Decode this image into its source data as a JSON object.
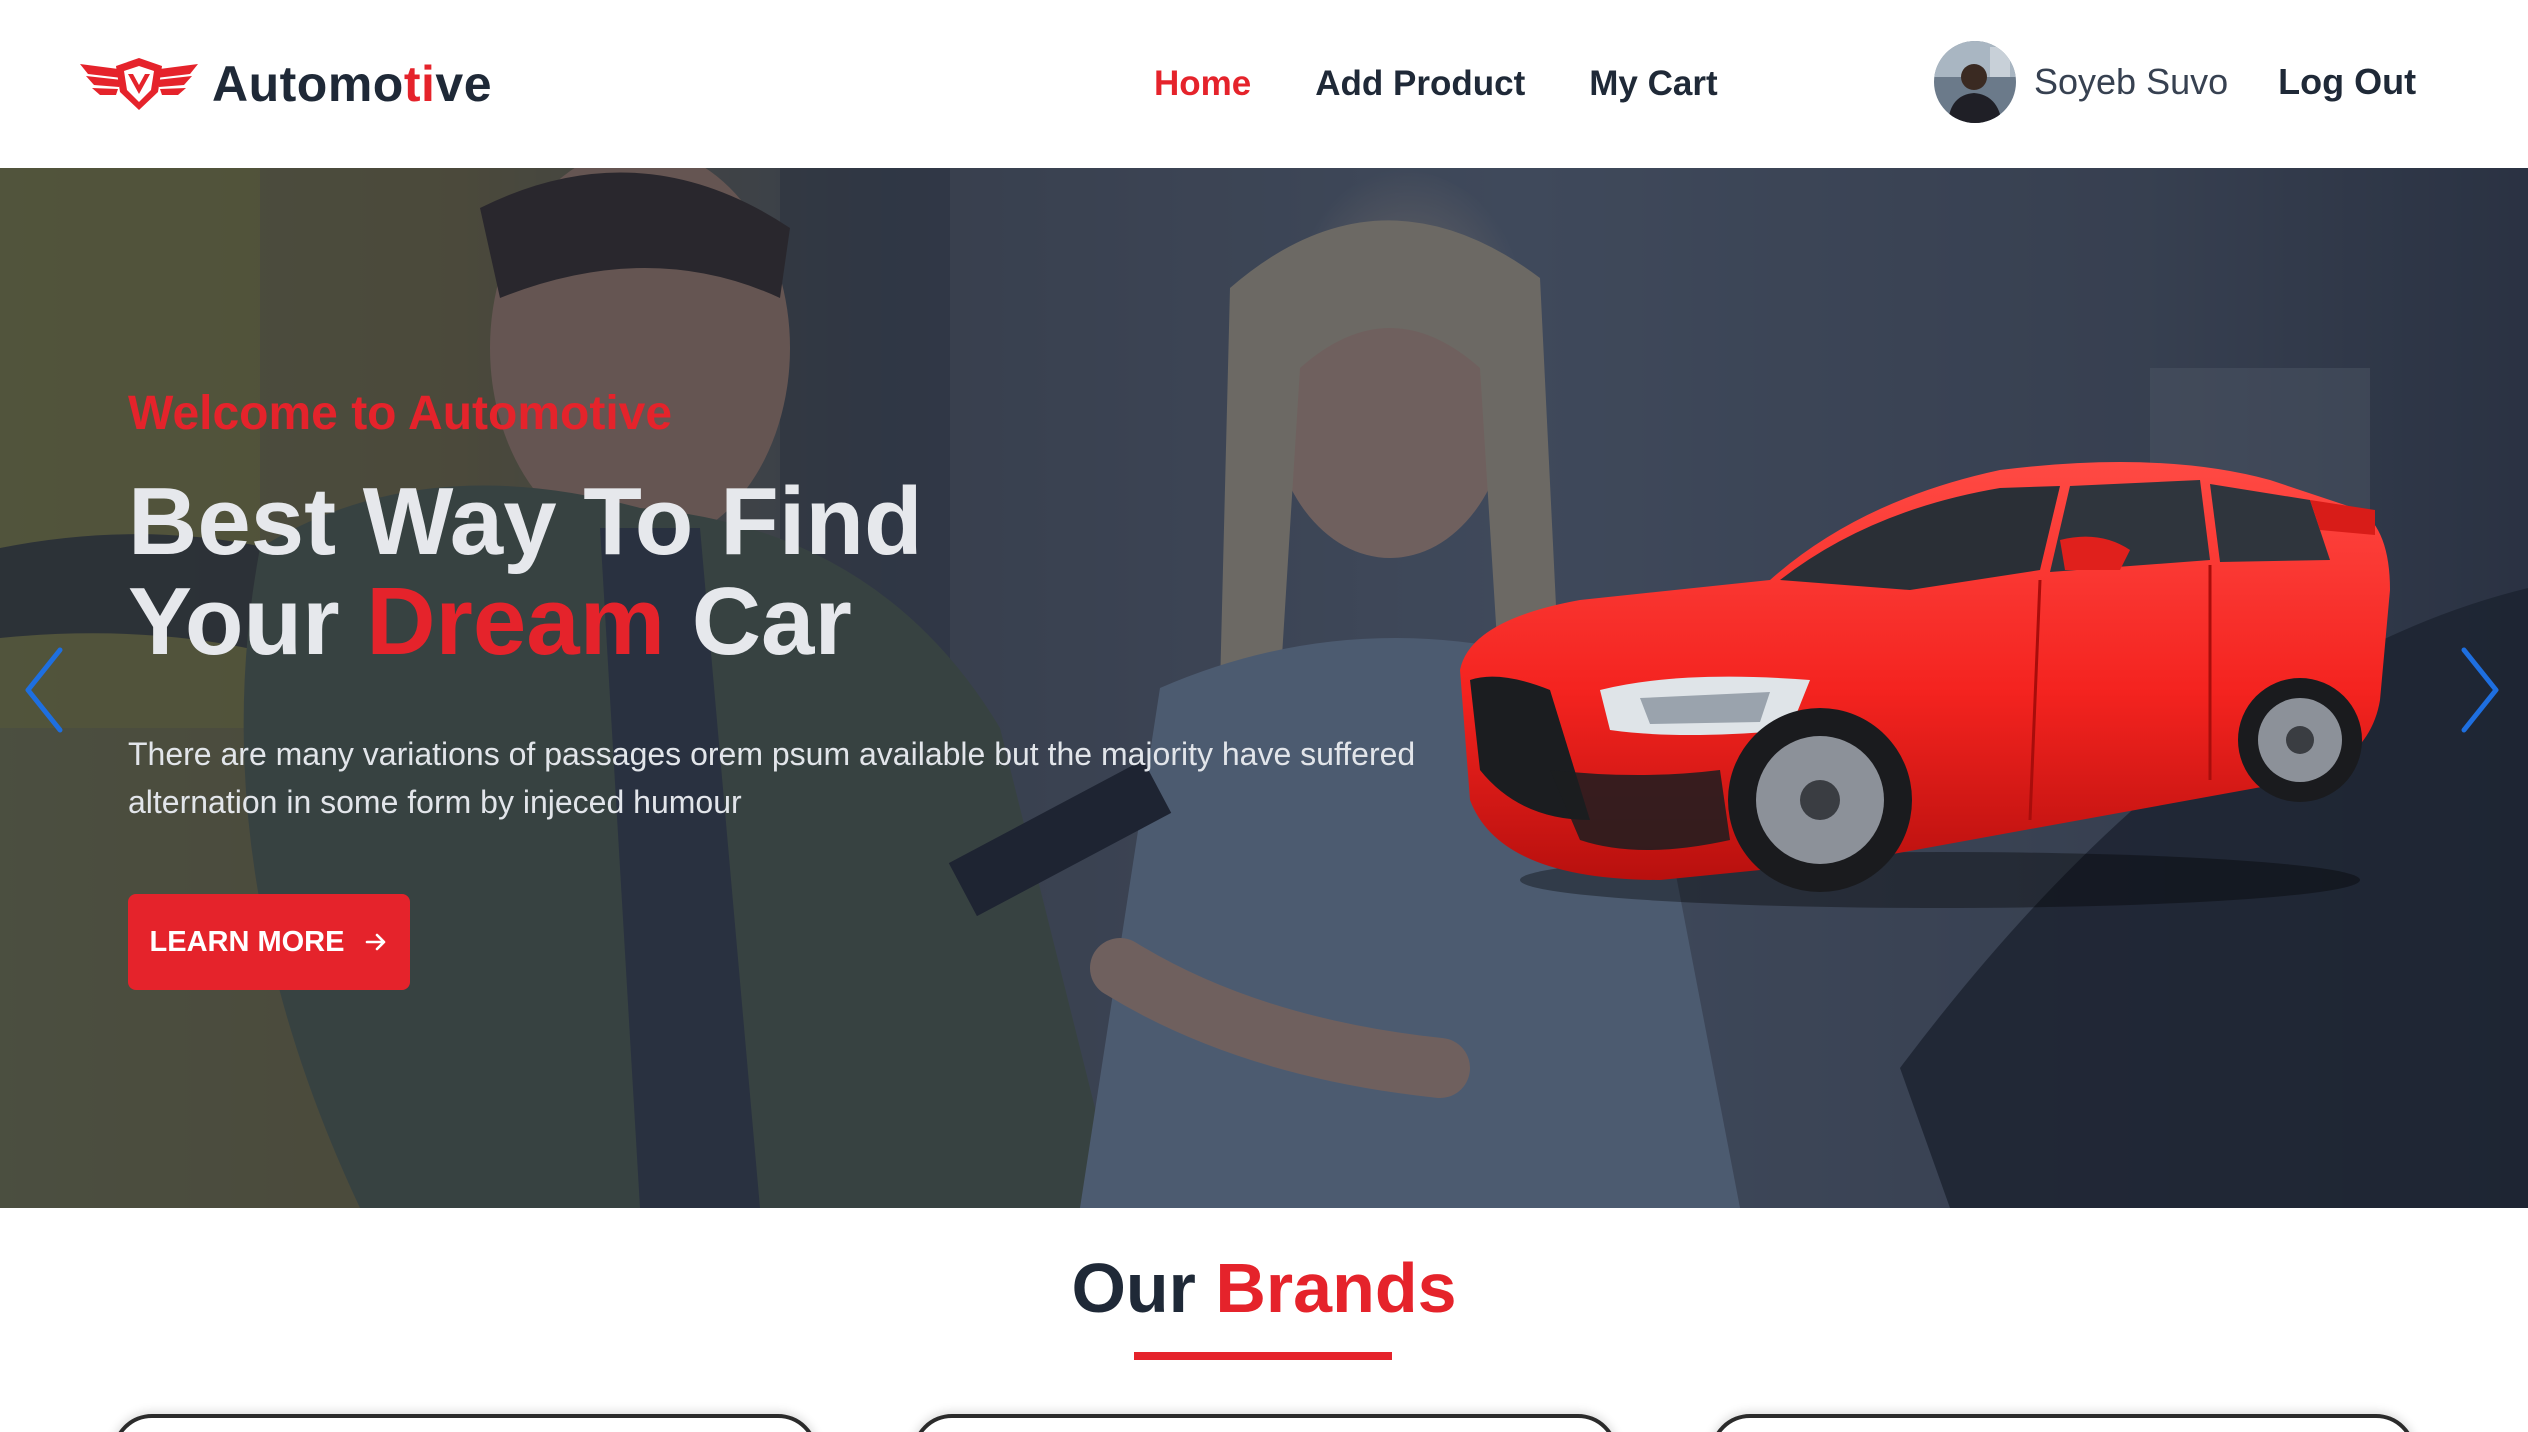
{
  "brand": {
    "name_part1": "Automo",
    "name_accent": "ti",
    "name_part2": "ve",
    "logo_icon": "winged-badge-icon"
  },
  "nav": {
    "links": [
      "Home",
      "Add Product",
      "My Cart"
    ],
    "active": "Home"
  },
  "user": {
    "name": "Soyeb Suvo",
    "logout_label": "Log Out"
  },
  "hero": {
    "kicker": "Welcome to Automotive",
    "title_line1": "Best Way To Find",
    "title_line2_before": "Your",
    "title_line2_accent": "Dream",
    "title_line2_after": "Car",
    "description": "There are many variations of passages orem psum available but the majority have suffered alternation in some form by injeced humour",
    "cta_label": "LEARN MORE",
    "cta_icon": "arrow-right-icon",
    "prev_icon": "chevron-left-icon",
    "next_icon": "chevron-right-icon"
  },
  "brands": {
    "title_part1": "Our",
    "title_part2": "Brands",
    "card_count": 3
  },
  "colors": {
    "accent": "#e5232b",
    "dark_text": "#1f2937",
    "carousel_arrow": "#1e6fe0",
    "hero_overlay": "#1e2534"
  }
}
